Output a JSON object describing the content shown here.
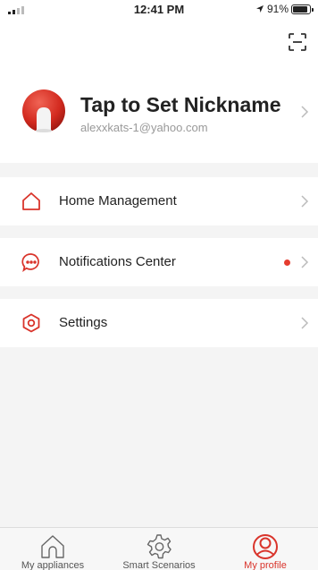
{
  "status": {
    "time": "12:41 PM",
    "battery": "91%",
    "battery_level": 0.91
  },
  "header": {
    "scan_icon": "scan-icon"
  },
  "profile": {
    "avatar": "avatar-icon",
    "nickname": "Tap to Set Nickname",
    "email": "alexxkats-1@yahoo.com"
  },
  "menu": {
    "home": {
      "label": "Home Management",
      "icon": "house-icon"
    },
    "notifications": {
      "label": "Notifications Center",
      "icon": "message-icon",
      "has_badge": true
    },
    "settings": {
      "label": "Settings",
      "icon": "hexagon-gear-icon"
    }
  },
  "tabs": [
    {
      "label": "My appliances",
      "icon": "house-icon",
      "active": false
    },
    {
      "label": "Smart Scenarios",
      "icon": "gear-icon",
      "active": false
    },
    {
      "label": "My profile",
      "icon": "profile-icon",
      "active": true
    }
  ],
  "colors": {
    "accent": "#d9342b",
    "background": "#f4f4f4",
    "card": "#ffffff"
  }
}
